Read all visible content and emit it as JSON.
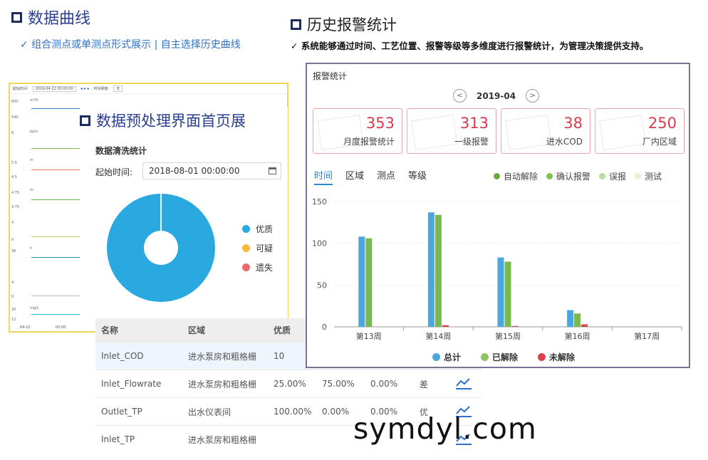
{
  "section1": {
    "title": "数据曲线",
    "subtitle": "✓ 组合测点或单测点形式展示 | 自主选择历史曲线"
  },
  "section2": {
    "title": "历史报警统计",
    "subtitle": "✓ 系统能够通过时间、工艺位置、报警等级等多维度进行报警统计，为管理决策提供支持。"
  },
  "trend_panel": {
    "start_label": "起始时间:",
    "start_value": "2019-04-22 00:00:00",
    "period_label": "时间频度:",
    "period_value": "天",
    "units": [
      "m³/h",
      "ppm",
      "m",
      "m",
      "h",
      "mg/L"
    ],
    "y_ticks": [
      "600",
      "540",
      "8",
      "5.5",
      "4.5",
      "4.75",
      "3.75",
      "4",
      "0",
      "36",
      "4",
      "0",
      "20",
      "12"
    ],
    "x_ticks": [
      "04-22",
      "02:00"
    ]
  },
  "preprocess": {
    "title": "数据预处理界面首页展",
    "clean_title": "数据清洗统计",
    "start_label": "起始时间:",
    "start_value": "2018-08-01 00:00:00",
    "legend": [
      {
        "label": "优质",
        "color": "#29a9e0"
      },
      {
        "label": "可疑",
        "color": "#f5b940"
      },
      {
        "label": "遗失",
        "color": "#ec6b6b"
      }
    ],
    "pie": [
      {
        "label": "优质",
        "value": 100,
        "color": "#29a9e0"
      }
    ]
  },
  "table": {
    "headers": [
      "名称",
      "区域",
      "优质"
    ],
    "rows": [
      {
        "name": "Inlet_COD",
        "area": "进水泵房和粗格栅",
        "c1": "10",
        "c2": "",
        "c3": "",
        "grade": ""
      },
      {
        "name": "Inlet_Flowrate",
        "area": "进水泵房和粗格栅",
        "c1": "25.00%",
        "c2": "75.00%",
        "c3": "0.00%",
        "grade": "差"
      },
      {
        "name": "Outlet_TP",
        "area": "出水仪表间",
        "c1": "100.00%",
        "c2": "0.00%",
        "c3": "0.00%",
        "grade": "优"
      },
      {
        "name": "Inlet_TP",
        "area": "进水泵房和粗格栅",
        "c1": "",
        "c2": "",
        "c3": "",
        "grade": ""
      }
    ]
  },
  "alarm": {
    "title": "报警统计",
    "month": "2019-04",
    "prev_icon": "chevron-left-icon",
    "next_icon": "chevron-right-icon",
    "cards": [
      {
        "value": "353",
        "label": "月度报警统计"
      },
      {
        "value": "313",
        "label": "一级报警"
      },
      {
        "value": "38",
        "label": "进水COD"
      },
      {
        "value": "250",
        "label": "厂内区域"
      }
    ],
    "tabs": [
      "时间",
      "区域",
      "测点",
      "等级"
    ],
    "legend_top": [
      {
        "label": "自动解除",
        "color": "#6aaa3c"
      },
      {
        "label": "确认报警",
        "color": "#7fc24f"
      },
      {
        "label": "误报",
        "color": "#b9dc9d"
      },
      {
        "label": "测试",
        "color": "#e6f1d6"
      }
    ],
    "legend_bottom": [
      {
        "label": "总计",
        "color": "#4aa7e0"
      },
      {
        "label": "已解除",
        "color": "#8cc466"
      },
      {
        "label": "未解除",
        "color": "#d9434e"
      }
    ]
  },
  "chart_data": {
    "type": "bar",
    "categories": [
      "第13周",
      "第14周",
      "第15周",
      "第16周",
      "第17周"
    ],
    "ylim": [
      0,
      150
    ],
    "yticks": [
      0,
      50,
      100,
      150
    ],
    "series": [
      {
        "name": "总计",
        "color": "#4aa7e0",
        "values": [
          108,
          137,
          83,
          20,
          0
        ]
      },
      {
        "name": "已解除",
        "color": "#7ab851",
        "values": [
          106,
          134,
          78,
          16,
          0
        ]
      },
      {
        "name": "未解除",
        "color": "#d9434e",
        "values": [
          0,
          2,
          1,
          3,
          0
        ]
      }
    ]
  },
  "watermark": "symdyl.com"
}
